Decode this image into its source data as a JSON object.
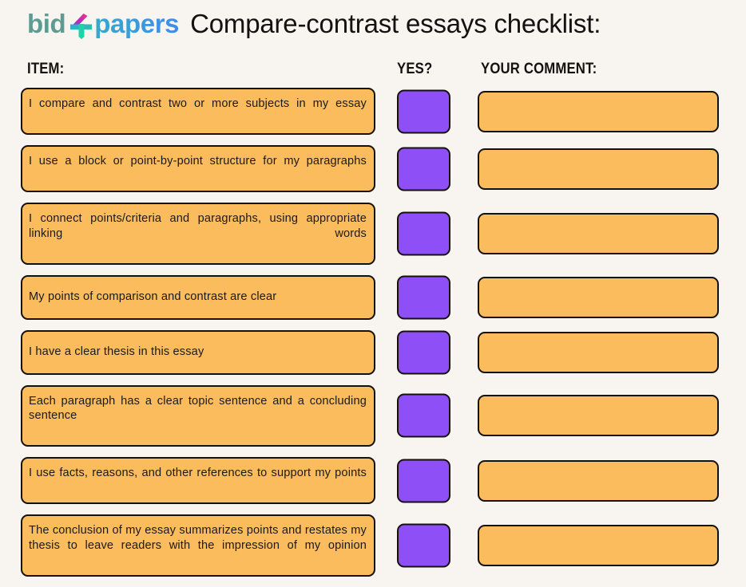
{
  "brand": {
    "name_part1": "bid",
    "name_part2": "papers",
    "mark_icon": "four-logo-mark-icon",
    "color_part1": "#5c9c93",
    "color_part2_start": "#35a9cd",
    "color_part2_end": "#3f8ced",
    "dot_color": "#c02bd3"
  },
  "page": {
    "title": "Compare-contrast essays checklist:",
    "background_color": "#f8f4ef",
    "text_color": "#14110f"
  },
  "columns": {
    "item": "ITEM:",
    "yes": "YES?",
    "comment": "YOUR COMMENT:"
  },
  "styles": {
    "item_box_color": "#fbbc5e",
    "yes_box_color": "#8f4ff7",
    "comment_box_color": "#fbbc5e",
    "border_color": "#14110f"
  },
  "rows": [
    {
      "item": "I compare and contrast two or more subjects in my essay",
      "lines": 2,
      "yes_checked": false,
      "comment": ""
    },
    {
      "item": "I use a block or point-by-point structure for my paragraphs",
      "lines": 2,
      "yes_checked": false,
      "comment": ""
    },
    {
      "item": "I connect points/criteria and paragraphs, using appropriate linking words",
      "lines": 2,
      "yes_checked": false,
      "comment": ""
    },
    {
      "item": "My points of comparison and contrast are clear",
      "lines": 1,
      "yes_checked": false,
      "comment": ""
    },
    {
      "item": "I have a clear thesis in this essay",
      "lines": 1,
      "yes_checked": false,
      "comment": ""
    },
    {
      "item": "Each paragraph has a clear topic sentence and a concluding sentence",
      "lines": 2,
      "yes_checked": false,
      "comment": ""
    },
    {
      "item": "I use facts, reasons, and other references to support my points",
      "lines": 2,
      "yes_checked": false,
      "comment": ""
    },
    {
      "item": "The conclusion of my essay summarizes points and restates my thesis to leave readers with the impression of my opinion",
      "lines": 3,
      "yes_checked": false,
      "comment": ""
    }
  ]
}
